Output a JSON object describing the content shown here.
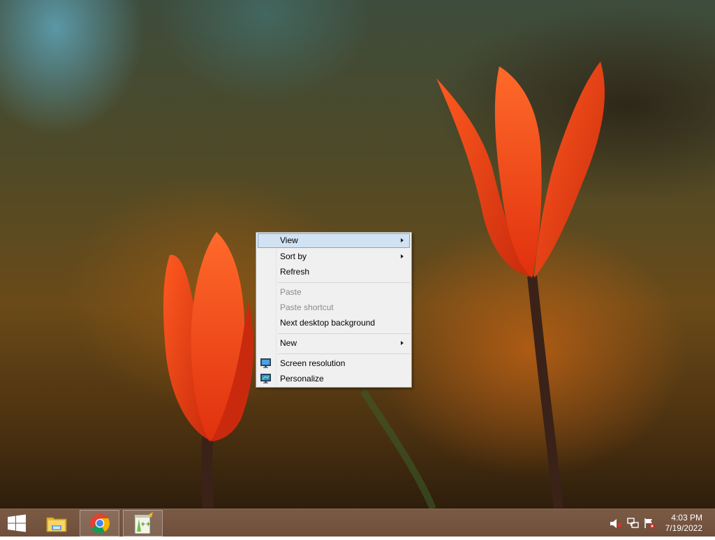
{
  "context_menu": {
    "items": [
      {
        "label": "View",
        "has_submenu": true,
        "highlighted": true
      },
      {
        "label": "Sort by",
        "has_submenu": true
      },
      {
        "label": "Refresh"
      },
      {
        "label": "Paste",
        "disabled": true
      },
      {
        "label": "Paste shortcut",
        "disabled": true
      },
      {
        "label": "Next desktop background"
      },
      {
        "label": "New",
        "has_submenu": true
      },
      {
        "label": "Screen resolution",
        "icon": "monitor-icon"
      },
      {
        "label": "Personalize",
        "icon": "personalize-icon"
      }
    ]
  },
  "taskbar": {
    "start_icon": "windows-logo-icon",
    "apps": [
      {
        "name": "File Explorer",
        "icon": "folder-icon"
      },
      {
        "name": "Google Chrome",
        "icon": "chrome-icon",
        "active": true
      },
      {
        "name": "Notepad++",
        "icon": "notepad-plus-plus-icon",
        "active": true
      }
    ],
    "tray_icons": [
      "volume-muted-icon",
      "network-icon",
      "action-center-flag-icon"
    ],
    "clock": {
      "time": "4:03 PM",
      "date": "7/19/2022"
    }
  },
  "colors": {
    "taskbar": "#74543f",
    "menu_background": "#f0f0f0",
    "menu_highlight": "#d1e2f2",
    "tulip": "#f04a18"
  }
}
